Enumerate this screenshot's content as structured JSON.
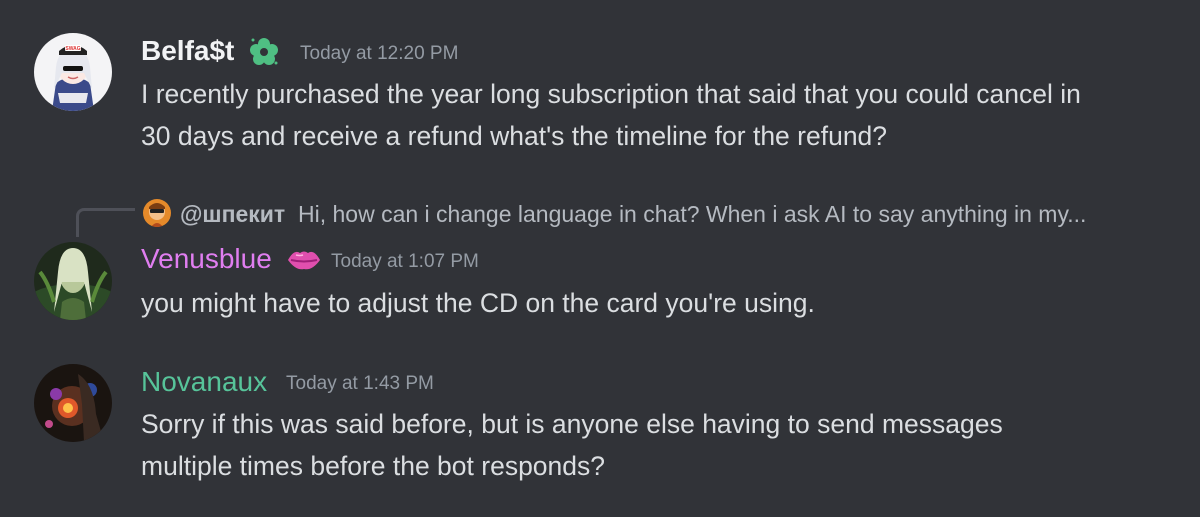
{
  "theme": {
    "background": "#313338",
    "text": "#dbdee1",
    "muted": "#949ba4",
    "username_default": "#f2f3f5",
    "username_venus": "#e07ef0",
    "username_nova": "#57c49a"
  },
  "messages": [
    {
      "username": "Belfa$t",
      "badge_icon": "flower-badge-icon",
      "timestamp": "Today at 12:20 PM",
      "content": "I recently purchased the year long subscription that said that you could cancel in 30 days and receive a refund what's the timeline for the refund?"
    },
    {
      "reply": {
        "username": "@шпекит",
        "text": "Hi, how can i change language in chat? When i ask AI to say anything in my..."
      },
      "username": "Venusblue",
      "badge_icon": "kiss-lips-icon",
      "timestamp": "Today at 1:07 PM",
      "content": "you might have to adjust the CD on the card you're using."
    },
    {
      "username": "Novanaux",
      "timestamp": "Today at 1:43 PM",
      "content": "Sorry if this was said before, but is anyone else having to send messages multiple times before the bot responds?"
    }
  ]
}
